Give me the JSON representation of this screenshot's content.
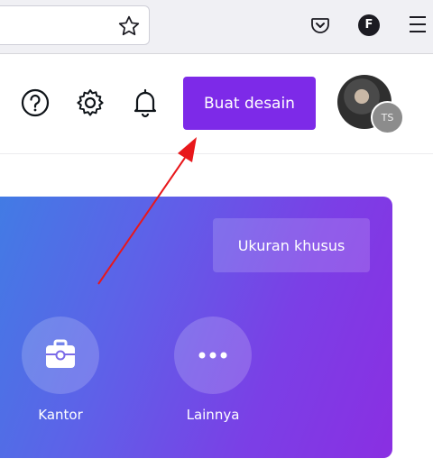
{
  "browser": {
    "profile_initial": "F",
    "icons": [
      "bookmark-star-icon",
      "pocket-icon",
      "profile-icon",
      "hamburger-menu-icon"
    ]
  },
  "header": {
    "icons": [
      "help-icon",
      "settings-gear-icon",
      "notification-bell-icon"
    ],
    "create_design_label": "Buat desain",
    "avatar_badge": "TS"
  },
  "banner": {
    "custom_size_label": "Ukuran khusus",
    "categories": [
      {
        "label": "Kantor",
        "icon": "briefcase-icon"
      },
      {
        "label": "Lainnya",
        "icon": "more-dots-icon"
      }
    ]
  },
  "colors": {
    "primary": "#7d2ae8",
    "banner_start": "#3f7ee4",
    "banner_end": "#8a2fe2",
    "annotation_arrow": "#e8171b"
  }
}
